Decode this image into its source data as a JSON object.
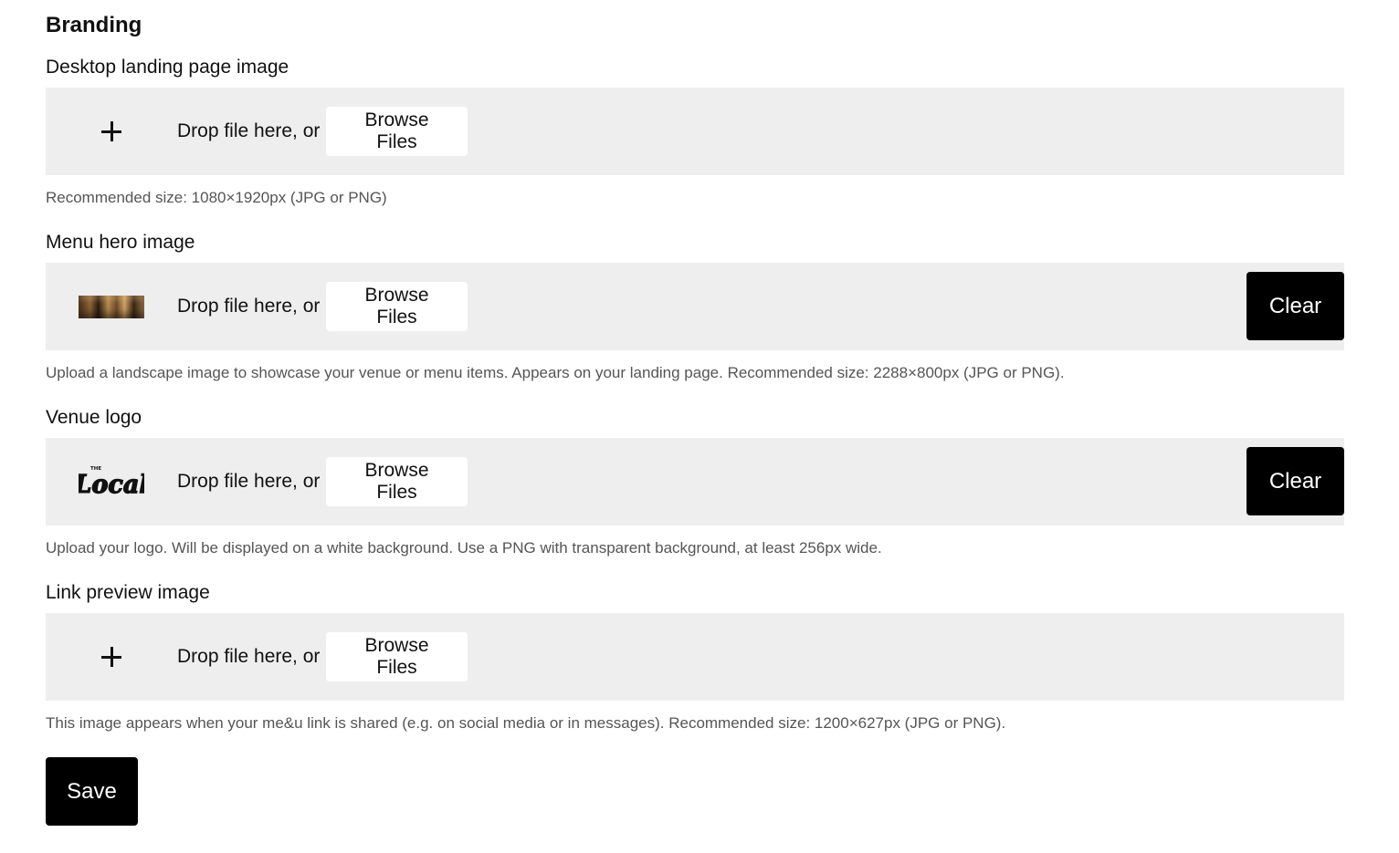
{
  "section": {
    "title": "Branding"
  },
  "fields": [
    {
      "label": "Desktop landing page image",
      "thumbnail": "plus-icon",
      "drop_text": "Drop file here, or",
      "browse_label": "Browse Files",
      "clear_label": null,
      "help": "Recommended size: 1080×1920px (JPG or PNG)"
    },
    {
      "label": "Menu hero image",
      "thumbnail": "hero-image-thumbnail",
      "drop_text": "Drop file here, or",
      "browse_label": "Browse Files",
      "clear_label": "Clear",
      "help": "Upload a landscape image to showcase your venue or menu items. Appears on your landing page. Recommended size: 2288×800px (JPG or PNG)."
    },
    {
      "label": "Venue logo",
      "thumbnail": "venue-logo-thumbnail",
      "logo_small_text": "THE",
      "logo_text": "Local",
      "drop_text": "Drop file here, or",
      "browse_label": "Browse Files",
      "clear_label": "Clear",
      "help": "Upload your logo. Will be displayed on a white background. Use a PNG with transparent background, at least 256px wide."
    },
    {
      "label": "Link preview image",
      "thumbnail": "plus-icon",
      "drop_text": "Drop file here, or",
      "browse_label": "Browse Files",
      "clear_label": null,
      "help": "This image appears when your me&u link is shared (e.g. on social media or in messages). Recommended size: 1200×627px (JPG or PNG)."
    }
  ],
  "actions": {
    "save_label": "Save"
  },
  "colors": {
    "dropzone_bg": "#eeeeee",
    "button_dark": "#000000",
    "help_text": "#555555"
  }
}
